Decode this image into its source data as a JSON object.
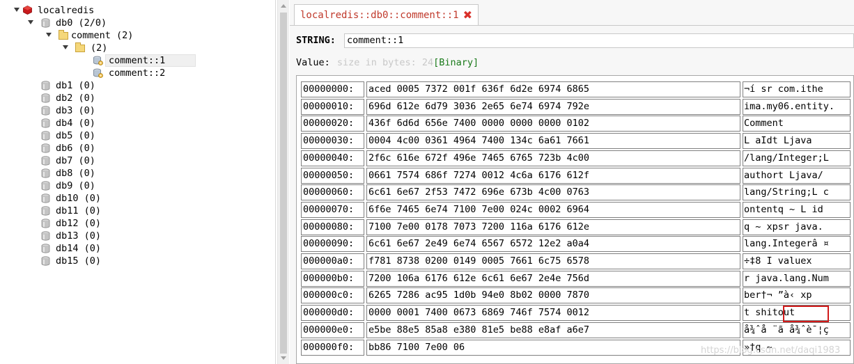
{
  "tree": {
    "connection": "localredis",
    "db0": {
      "name": "db0",
      "count": "(2/0)"
    },
    "folder_comment": {
      "name": "comment",
      "count": "(2)"
    },
    "folder_empty": {
      "name": "",
      "count": "(2)"
    },
    "keys": [
      "comment::1",
      "comment::2"
    ],
    "databases": [
      {
        "name": "db1",
        "count": "(0)"
      },
      {
        "name": "db2",
        "count": "(0)"
      },
      {
        "name": "db3",
        "count": "(0)"
      },
      {
        "name": "db4",
        "count": "(0)"
      },
      {
        "name": "db5",
        "count": "(0)"
      },
      {
        "name": "db6",
        "count": "(0)"
      },
      {
        "name": "db7",
        "count": "(0)"
      },
      {
        "name": "db8",
        "count": "(0)"
      },
      {
        "name": "db9",
        "count": "(0)"
      },
      {
        "name": "db10",
        "count": "(0)"
      },
      {
        "name": "db11",
        "count": "(0)"
      },
      {
        "name": "db12",
        "count": "(0)"
      },
      {
        "name": "db13",
        "count": "(0)"
      },
      {
        "name": "db14",
        "count": "(0)"
      },
      {
        "name": "db15",
        "count": "(0)"
      }
    ]
  },
  "tab": {
    "label": "localredis::db0::comment::1",
    "close_icon": "close-icon"
  },
  "key": {
    "type_label": "STRING:",
    "name": "comment::1"
  },
  "value": {
    "label": "Value:",
    "size_text": "size in bytes: 24",
    "mode": "[Binary]"
  },
  "hex_rows": [
    {
      "addr": "00000000:",
      "hex": "aced 0005 7372 001f 636f 6d2e 6974 6865",
      "ascii": "¬í sr com.ithe"
    },
    {
      "addr": "00000010:",
      "hex": "696d 612e 6d79 3036 2e65 6e74 6974 792e",
      "ascii": "ima.my06.entity."
    },
    {
      "addr": "00000020:",
      "hex": "436f 6d6d 656e 7400 0000 0000 0000 0102",
      "ascii": "Comment"
    },
    {
      "addr": "00000030:",
      "hex": "0004 4c00 0361 4964 7400 134c 6a61 7661",
      "ascii": " L aIdt Ljava"
    },
    {
      "addr": "00000040:",
      "hex": "2f6c 616e 672f 496e 7465 6765 723b 4c00",
      "ascii": "/lang/Integer;L"
    },
    {
      "addr": "00000050:",
      "hex": "0661 7574 686f 7274 0012 4c6a 6176 612f",
      "ascii": "authort Ljava/"
    },
    {
      "addr": "00000060:",
      "hex": "6c61 6e67 2f53 7472 696e 673b 4c00 0763",
      "ascii": "lang/String;L c"
    },
    {
      "addr": "00000070:",
      "hex": "6f6e 7465 6e74 7100 7e00 024c 0002 6964",
      "ascii": "ontentq ~ L id"
    },
    {
      "addr": "00000080:",
      "hex": "7100 7e00 0178 7073 7200 116a 6176 612e",
      "ascii": "q ~  xpsr java."
    },
    {
      "addr": "00000090:",
      "hex": "6c61 6e67 2e49 6e74 6567 6572 12e2 a0a4",
      "ascii": "lang.Integerâ  ¤"
    },
    {
      "addr": "000000a0:",
      "hex": "f781 8738 0200 0149 0005 7661 6c75 6578",
      "ascii": "÷‡8   I valuex"
    },
    {
      "addr": "000000b0:",
      "hex": "7200 106a 6176 612e 6c61 6e67 2e4e 756d",
      "ascii": "r java.lang.Num"
    },
    {
      "addr": "000000c0:",
      "hex": "6265 7286 ac95 1d0b 94e0 8b02 0000 7870",
      "ascii": "ber†¬ ”à‹  xp"
    },
    {
      "addr": "000000d0:",
      "hex": "0000 0001 7400 0673 6869 746f 7574 0012",
      "ascii": "     t shitout"
    },
    {
      "addr": "000000e0:",
      "hex": "e5be 88e5 85a8 e380 81e5 be88 e8af a6e7",
      "ascii": "å¾ˆå ¨ã å¾ˆè¯¦ç"
    },
    {
      "addr": "000000f0:",
      "hex": "bb86 7100 7e00 06",
      "ascii": "»†q ~"
    }
  ],
  "watermark": "https://blog.csdn.net/daqi1983"
}
